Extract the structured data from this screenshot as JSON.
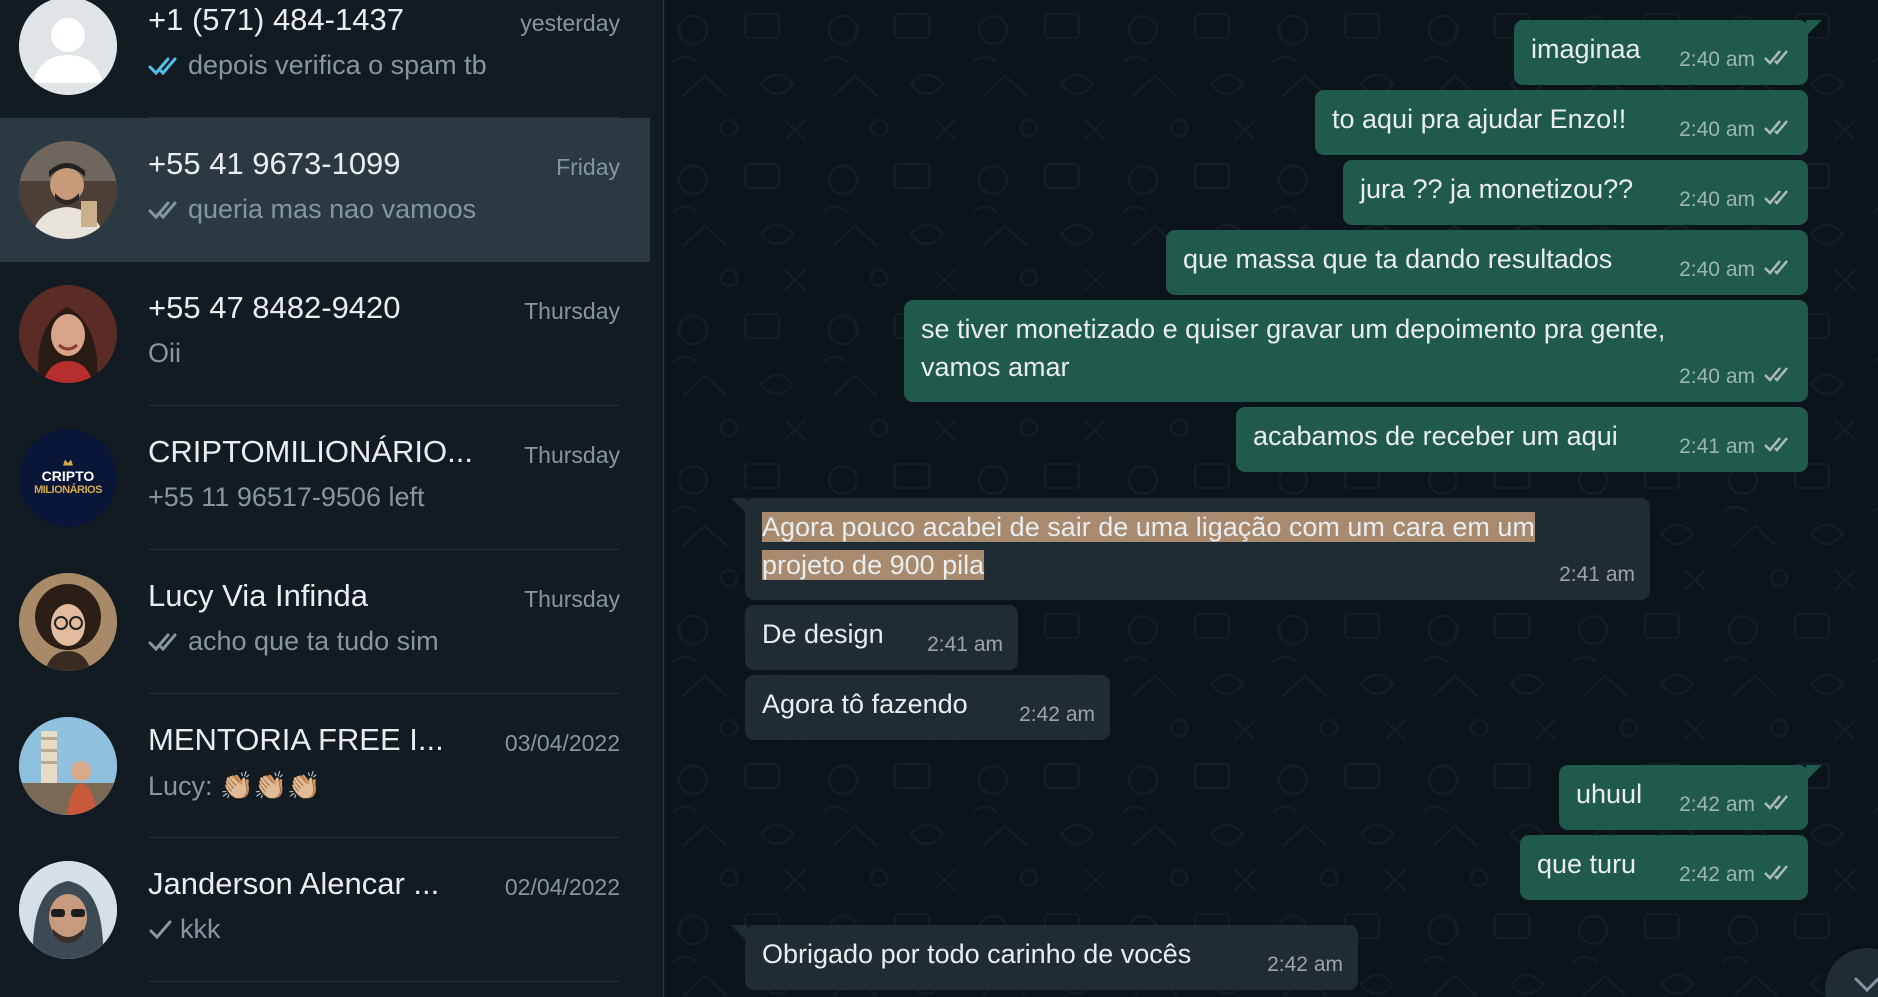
{
  "chats": [
    {
      "name": "+1 (571) 484-1437",
      "time": "yesterday",
      "preview": "depois verifica o spam tb",
      "tick": "read"
    },
    {
      "name": "+55 41 9673-1099",
      "time": "Friday",
      "preview": "queria mas nao vamoos",
      "tick": "delivered"
    },
    {
      "name": "+55 47 8482-9420",
      "time": "Thursday",
      "preview": "Oii",
      "tick": "none"
    },
    {
      "name": "CRIPTOMILIONÁRIO...",
      "time": "Thursday",
      "preview": "+55 11 96517-9506 left",
      "tick": "none",
      "avatar_text_1": "CRIPTO",
      "avatar_text_2": "MILIONÁRIOS"
    },
    {
      "name": "Lucy Via Infinda",
      "time": "Thursday",
      "preview": "acho que ta tudo sim",
      "tick": "delivered"
    },
    {
      "name": "MENTORIA FREE I...",
      "time": "03/04/2022",
      "preview": "Lucy: 👏🏼👏🏼👏🏼",
      "tick": "none"
    },
    {
      "name": "Janderson Alencar ...",
      "time": "02/04/2022",
      "preview": "kkk",
      "tick": "sent"
    }
  ],
  "messages": [
    {
      "dir": "out",
      "text": "imaginaa",
      "time": "2:40 am"
    },
    {
      "dir": "out",
      "text": "to aqui pra ajudar Enzo!!",
      "time": "2:40 am"
    },
    {
      "dir": "out",
      "text": "jura ?? ja monetizou??",
      "time": "2:40 am"
    },
    {
      "dir": "out",
      "text": "que massa que ta dando resultados",
      "time": "2:40 am"
    },
    {
      "dir": "out",
      "text_line1": "se tiver monetizado e quiser gravar um depoimento pra gente,",
      "text_line2": "vamos amar",
      "time": "2:40 am"
    },
    {
      "dir": "out",
      "text": "acabamos de receber um aqui",
      "time": "2:41 am"
    },
    {
      "dir": "in",
      "text_line1": "Agora pouco acabei de sair de uma ligação com um cara em um",
      "text_line2": "projeto de 900 pila",
      "time": "2:41 am"
    },
    {
      "dir": "in",
      "text": "De design",
      "time": "2:41 am"
    },
    {
      "dir": "in",
      "text": "Agora tô fazendo",
      "time": "2:42 am"
    },
    {
      "dir": "out",
      "text": "uhuul",
      "time": "2:42 am"
    },
    {
      "dir": "out",
      "text": "que turu",
      "time": "2:42 am"
    },
    {
      "dir": "in",
      "text": "Obrigado por todo carinho de vocês",
      "time": "2:42 am"
    }
  ],
  "colors": {
    "background": "#111b21",
    "chat_bg": "#0b141a",
    "outgoing_bubble": "#1f5a4a",
    "incoming_bubble": "#202c33",
    "read_tick": "#53bdeb",
    "highlight": "#a88b6e"
  }
}
